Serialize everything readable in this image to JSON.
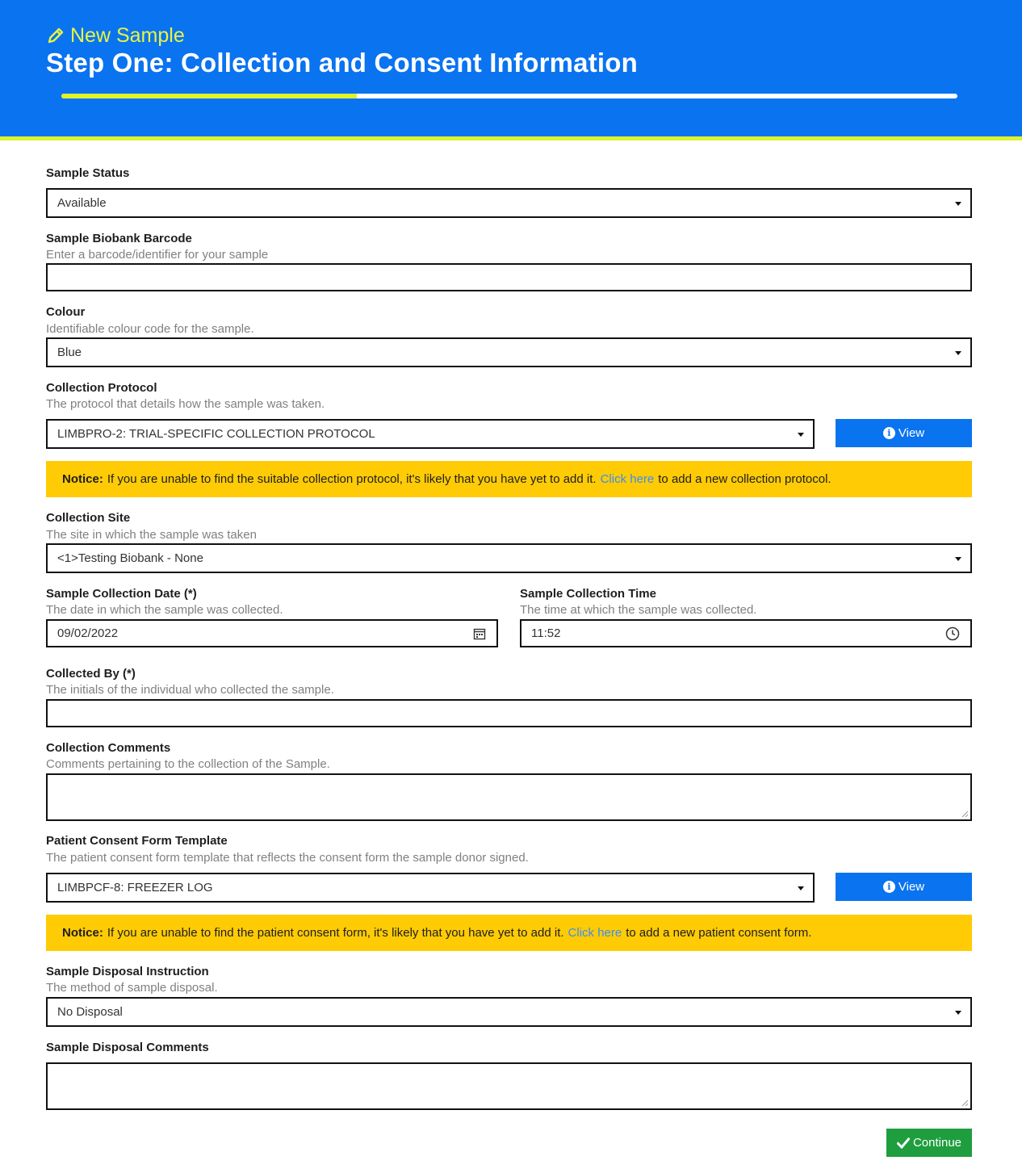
{
  "header": {
    "subtitle": "New Sample",
    "title": "Step One: Collection and Consent Information",
    "progress_percent": 33,
    "accent_color": "#dff22e",
    "brand_color": "#0a73f0",
    "subtitle_icon": "pencil-icon"
  },
  "form": {
    "sample_status": {
      "label": "Sample Status",
      "value": "Available"
    },
    "barcode": {
      "label": "Sample Biobank Barcode",
      "hint": "Enter a barcode/identifier for your sample",
      "value": ""
    },
    "colour": {
      "label": "Colour",
      "hint": "Identifiable colour code for the sample.",
      "value": "Blue"
    },
    "protocol": {
      "label": "Collection Protocol",
      "hint": "The protocol that details how the sample was taken.",
      "value": "LIMBPRO-2: TRIAL-SPECIFIC COLLECTION PROTOCOL",
      "view_label": "View"
    },
    "protocol_notice": {
      "strong": "Notice:",
      "before": "If you are unable to find the suitable collection protocol, it's likely that you have yet to add it.",
      "link": "Click here",
      "after": "to add a new collection protocol."
    },
    "site": {
      "label": "Collection Site",
      "hint": "The site in which the sample was taken",
      "value": "<1>Testing Biobank - None"
    },
    "date": {
      "label": "Sample Collection Date (*)",
      "hint": "The date in which the sample was collected.",
      "value": "09/02/2022"
    },
    "time": {
      "label": "Sample Collection Time",
      "hint": "The time at which the sample was collected.",
      "value": "11:52"
    },
    "collected_by": {
      "label": "Collected By (*)",
      "hint": "The initials of the individual who collected the sample.",
      "value": ""
    },
    "comments": {
      "label": "Collection Comments",
      "hint": "Comments pertaining to the collection of the Sample.",
      "value": ""
    },
    "consent": {
      "label": "Patient Consent Form Template",
      "hint": "The patient consent form template that reflects the consent form the sample donor signed.",
      "value": "LIMBPCF-8: FREEZER LOG",
      "view_label": "View"
    },
    "consent_notice": {
      "strong": "Notice:",
      "before": "If you are unable to find the patient consent form, it's likely that you have yet to add it.",
      "link": "Click here",
      "after": "to add a new patient consent form."
    },
    "disposal": {
      "label": "Sample Disposal Instruction",
      "hint": "The method of sample disposal.",
      "value": "No Disposal"
    },
    "disposal_comments": {
      "label": "Sample Disposal Comments",
      "value": ""
    }
  },
  "actions": {
    "continue_label": "Continue",
    "continue_color": "#1e9e3e"
  }
}
